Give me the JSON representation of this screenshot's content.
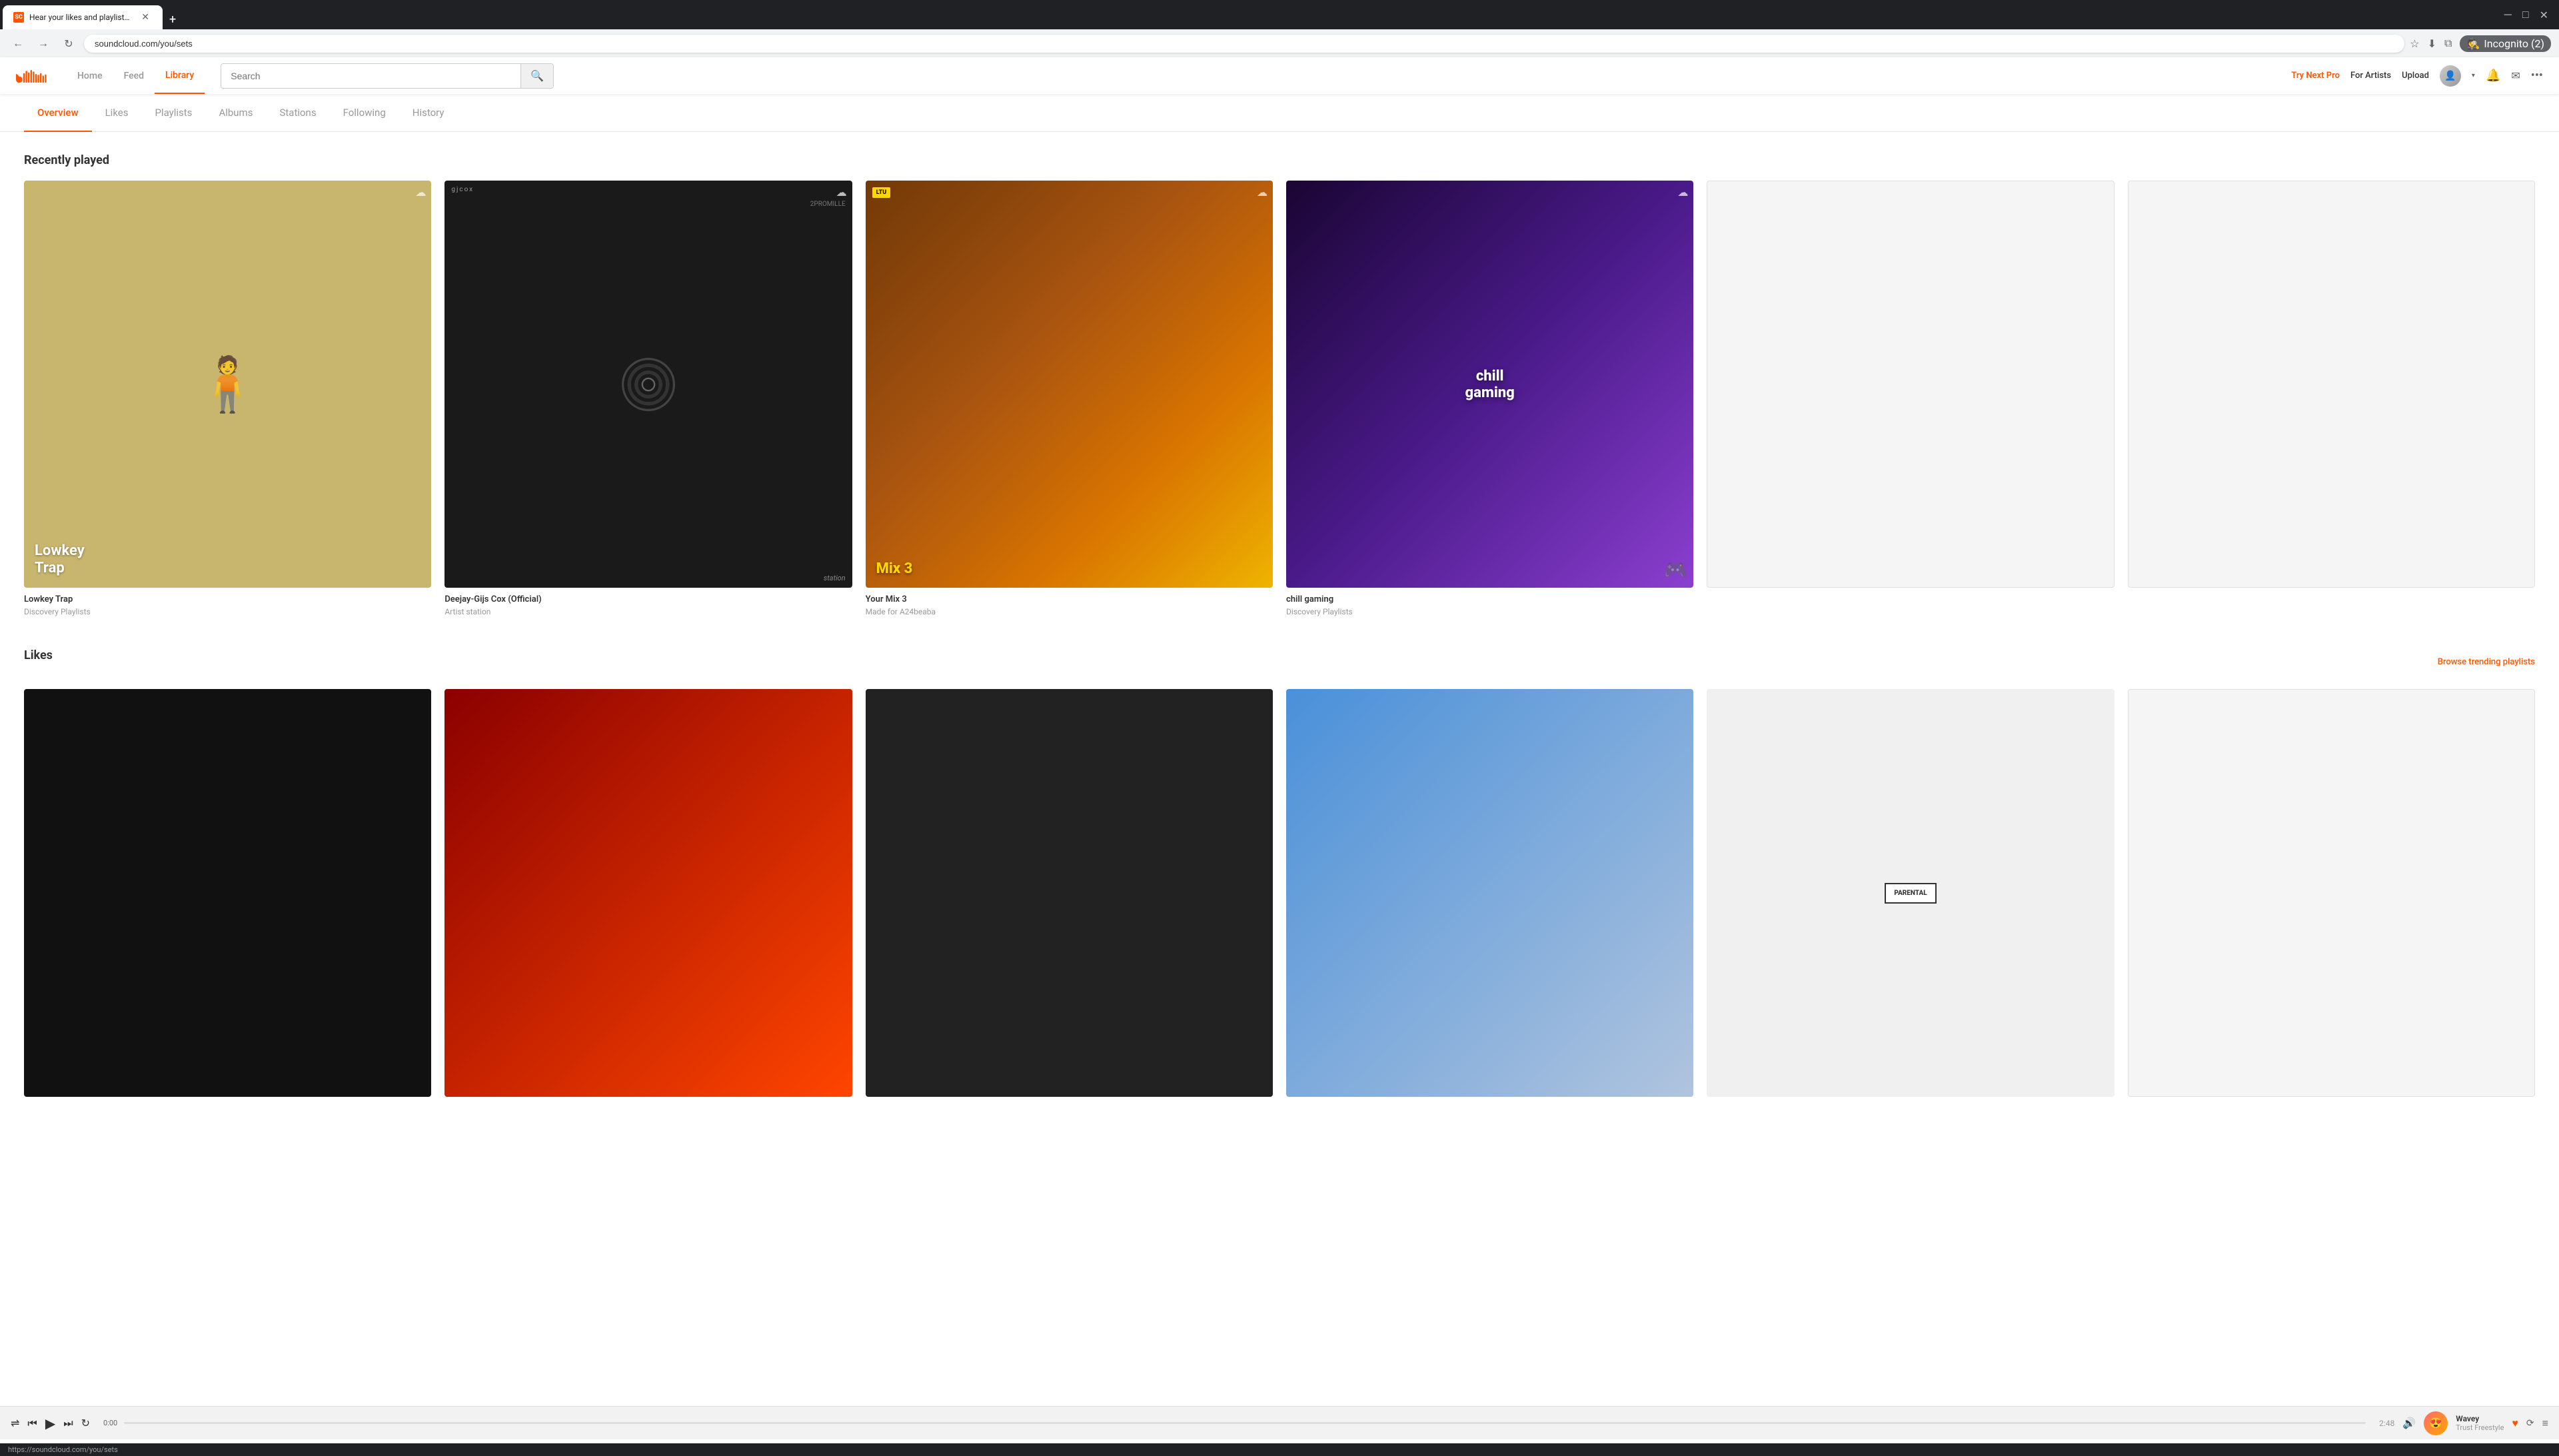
{
  "browser": {
    "tab_title": "Hear your likes and playlists, an",
    "tab_favicon": "SC",
    "address": "soundcloud.com/you/sets",
    "new_tab_label": "+",
    "incognito_label": "Incognito (2)",
    "status_url": "https://soundcloud.com/you/sets"
  },
  "nav": {
    "home_label": "Home",
    "feed_label": "Feed",
    "library_label": "Library",
    "search_placeholder": "Search",
    "try_next_pro_label": "Try Next Pro",
    "for_artists_label": "For Artists",
    "upload_label": "Upload"
  },
  "sub_nav": {
    "tabs": [
      {
        "id": "overview",
        "label": "Overview",
        "active": true
      },
      {
        "id": "likes",
        "label": "Likes",
        "active": false
      },
      {
        "id": "playlists",
        "label": "Playlists",
        "active": false
      },
      {
        "id": "albums",
        "label": "Albums",
        "active": false
      },
      {
        "id": "stations",
        "label": "Stations",
        "active": false
      },
      {
        "id": "following",
        "label": "Following",
        "active": false
      },
      {
        "id": "history",
        "label": "History",
        "active": false
      }
    ]
  },
  "recently_played": {
    "section_title": "Recently played",
    "cards": [
      {
        "id": "lowkey-trap",
        "name": "Lowkey Trap",
        "sub": "Discovery Playlists",
        "type": "playlist"
      },
      {
        "id": "deejay-gijs",
        "name": "Deejay-Gijs Cox (Official)",
        "sub": "Artist station",
        "type": "station"
      },
      {
        "id": "your-mix-3",
        "name": "Your Mix 3",
        "sub": "Made for A24beaba",
        "type": "mix"
      },
      {
        "id": "chill-gaming",
        "name": "chill gaming",
        "sub": "Discovery Playlists",
        "type": "playlist"
      },
      {
        "id": "empty1",
        "name": "",
        "sub": "",
        "type": "empty"
      },
      {
        "id": "empty2",
        "name": "",
        "sub": "",
        "type": "empty"
      }
    ]
  },
  "likes": {
    "section_title": "Likes",
    "browse_trending_label": "Browse trending playlists"
  },
  "player": {
    "time_current": "0:00",
    "time_total": "2:48",
    "track_name": "Wavey",
    "track_artist": "Trust Freestyle"
  }
}
